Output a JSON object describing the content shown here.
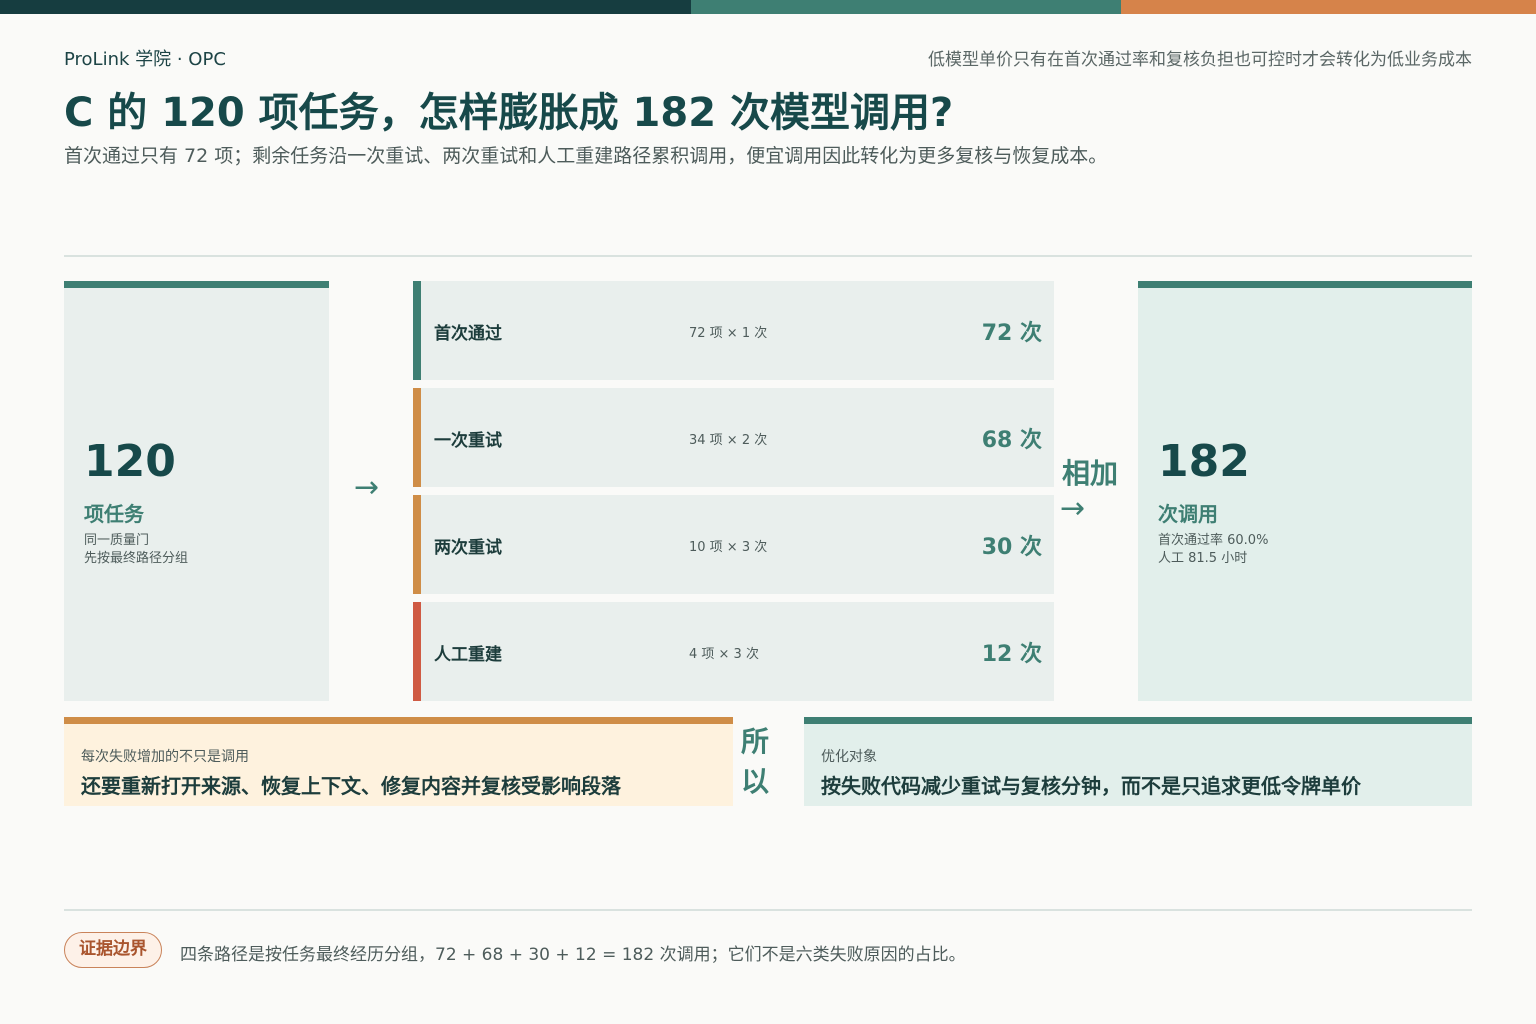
{
  "header": {
    "brand": "ProLink 学院 · OPC",
    "tagline": "低模型单价只有在首次通过率和复核负担也可控时才会转化为低业务成本",
    "title": "C 的 120 项任务，怎样膨胀成 182 次模型调用?",
    "subtitle": "首次通过只有 72 项；剩余任务沿一次重试、两次重试和人工重建路径累积调用，便宜调用因此转化为更多复核与恢复成本。"
  },
  "colors": {
    "teal_dark": "#163d40",
    "teal": "#3e7f73",
    "orange": "#d6834a",
    "amber": "#cf8d47",
    "red": "#cf5a43"
  },
  "input": {
    "value": "120",
    "unit": "项任务",
    "note_lines": [
      "同一质量门",
      "先按最终路径分组"
    ]
  },
  "arrow_icon": "→",
  "paths": [
    {
      "label": "首次通过",
      "formula": "72 项 × 1 次",
      "value": "72 次",
      "color": "#3e7f73"
    },
    {
      "label": "一次重试",
      "formula": "34 项 × 2 次",
      "value": "68 次",
      "color": "#cf8d47"
    },
    {
      "label": "两次重试",
      "formula": "10 项 × 3 次",
      "value": "30 次",
      "color": "#cf8d47"
    },
    {
      "label": "人工重建",
      "formula": "4 项 × 3 次",
      "value": "12 次",
      "color": "#cf5a43"
    }
  ],
  "sum_label": "相加",
  "output": {
    "value": "182",
    "unit": "次调用",
    "note_lines": [
      "首次通过率 60.0%",
      "人工 81.5 小时"
    ]
  },
  "callouts": {
    "warning": {
      "kicker": "每次失败增加的不只是调用",
      "message": "还要重新打开来源、恢复上下文、修复内容并复核受影响段落"
    },
    "therefore_chars": [
      "所",
      "以"
    ],
    "action": {
      "kicker": "优化对象",
      "message": "按失败代码减少重试与复核分钟，而不是只追求更低令牌单价"
    }
  },
  "footer": {
    "badge": "证据边界",
    "note": "四条路径是按任务最终经历分组，72 + 68 + 30 + 12 = 182 次调用；它们不是六类失败原因的占比。"
  }
}
